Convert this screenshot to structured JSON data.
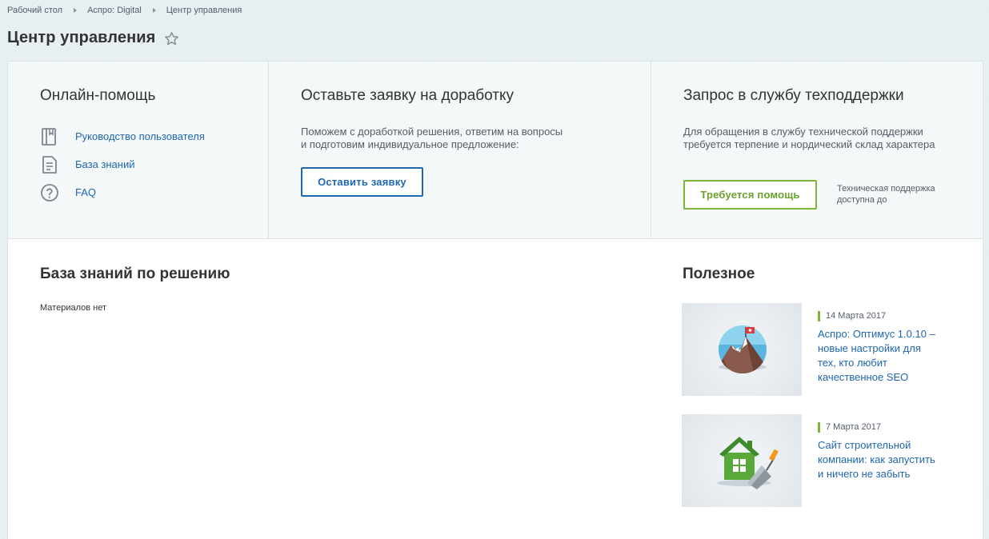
{
  "breadcrumb": {
    "items": [
      "Рабочий стол",
      "Аспро: Digital",
      "Центр управления"
    ]
  },
  "page": {
    "title": "Центр управления"
  },
  "online_help": {
    "title": "Онлайн-помощь",
    "items": [
      {
        "label": "Руководство пользователя",
        "icon": "book-icon"
      },
      {
        "label": "База знаний",
        "icon": "document-icon"
      },
      {
        "label": "FAQ",
        "icon": "question-circle-icon"
      }
    ]
  },
  "request": {
    "title": "Оставьте заявку на доработку",
    "description_line1": "Поможем с доработкой решения, ответим на вопросы",
    "description_line2": "и подготовим индивидуальное предложение:",
    "button_label": "Оставить заявку"
  },
  "support": {
    "title": "Запрос в службу техподдержки",
    "description": "Для обращения в службу технической поддержки требуется терпение и нордический склад характера",
    "button_label": "Требуется помощь",
    "note": "Техническая поддержка доступна до"
  },
  "knowledge_base": {
    "title": "База знаний по решению",
    "empty_text": "Материалов нет"
  },
  "useful": {
    "title": "Полезное",
    "articles": [
      {
        "date": "14 Марта 2017",
        "title": "Аспро: Оптимус 1.0.10 – новые настройки для тех, кто любит качественное SEO",
        "image": "mountain-flag-icon"
      },
      {
        "date": "7 Марта 2017",
        "title": "Сайт строительной компании: как запустить и ничего не забыть",
        "image": "house-trowel-icon"
      }
    ]
  },
  "colors": {
    "link": "#2067b0",
    "accent_green": "#7bb63b",
    "background": "#e5eef0"
  }
}
